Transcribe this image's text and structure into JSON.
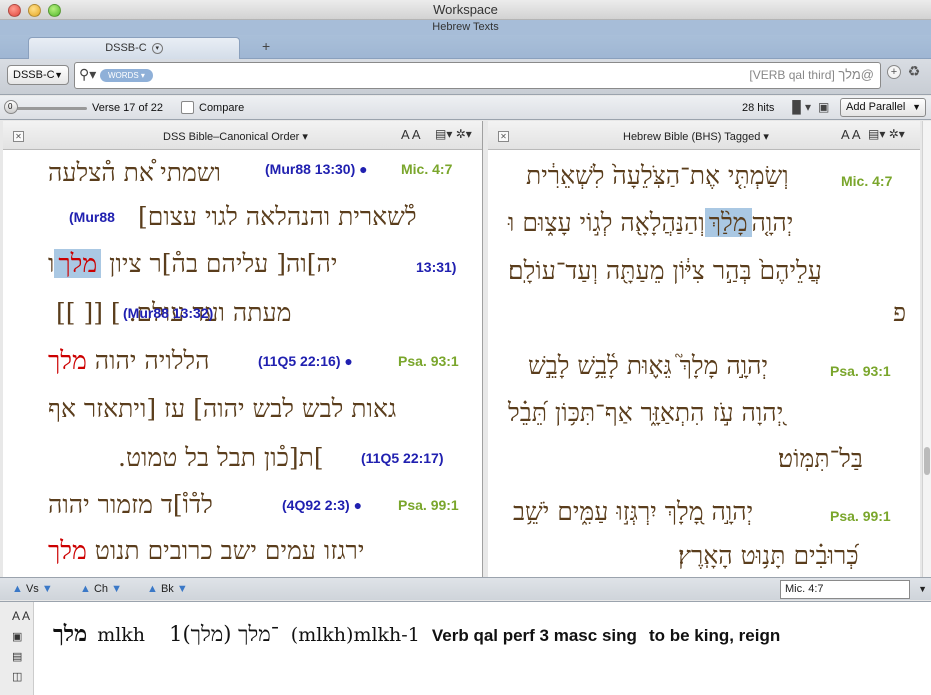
{
  "window": {
    "title": "Workspace",
    "subtitle": "Hebrew Texts"
  },
  "tabbar": {
    "tab_label": "DSSB-C",
    "add_label": "+"
  },
  "search": {
    "source_select": "DSSB-C",
    "mode_chip": "WORDS",
    "query_label": "[VERB qal third]",
    "query_hebrew": "מלך@",
    "add_icon": "plus-circle-icon",
    "recycle_icon": "recycle-icon"
  },
  "toolbar": {
    "slider_value": "0",
    "verse_text": "Verse 17 of 22",
    "compare_label": "Compare",
    "hits_text": "28 hits",
    "add_parallel_label": "Add Parallel"
  },
  "left_pane": {
    "title": "DSS Bible–Canonical Order",
    "font_size_label": "A A",
    "blocks": [
      {
        "ref": "Mic. 4:7",
        "lines": [
          {
            "manuscript": "(Mur88 13:30)",
            "text": "ושמתי ֯את ה֯צלעה"
          },
          {
            "manuscript": "(Mur88",
            "text": "ל֯שארית והנהלאה לגוי עצום]"
          },
          {
            "manuscript": "13:31)",
            "text_before": "ו",
            "highlight": "מלך",
            "text_after": "יה]וה[ עליהם בה֯]ר ציון"
          },
          {
            "manuscript": "(Mur88 13:32)",
            "text": "מעתה ועד עולם. ] [[ ]]"
          }
        ]
      },
      {
        "ref": "Psa. 93:1",
        "lines": [
          {
            "manuscript": "(11Q5 22:16)",
            "text": "הללויה יהוה",
            "red": "מלך"
          },
          {
            "manuscript": "",
            "text": "גאות לבש לבש יהוה] עז [ויתאזר אף"
          },
          {
            "manuscript": "(11Q5 22:17)",
            "text": "]ת[כ֯ון תבל בל טמוט."
          }
        ]
      },
      {
        "ref": "Psa. 99:1",
        "lines": [
          {
            "manuscript": "(4Q92 2:3)",
            "text": "לד֯ו֯]ד מזמור יהוה"
          },
          {
            "manuscript": "",
            "red": "מלך",
            "text": "ירגזו עמים ישב כרובים תנוט"
          }
        ]
      }
    ]
  },
  "right_pane": {
    "title": "Hebrew Bible (BHS) Tagged",
    "font_size_label": "A A",
    "blocks": [
      {
        "ref": "Mic. 4:7",
        "lines": [
          {
            "text": "וְשַׂמְתִּ֤י אֶת־הַצֹּֽלֵעָה֙ לִשְׁאֵרִ֔ית"
          },
          {
            "text_before": "וְהַנַּהֲלָאָ֖ה לְג֣וֹי עָצ֑וּם וּ",
            "highlight": "מָלַ֨ךְ",
            "text_after": " יְהוָ֤ה"
          },
          {
            "text": "עֲלֵיהֶם֙ בְּהַ֣ר צִיּ֔וֹן מֵעַתָּ֖ה וְעַד־עוֹלָֽם׃"
          },
          {
            "text": "פ"
          }
        ]
      },
      {
        "ref": "Psa. 93:1",
        "lines": [
          {
            "text": "יְהוָ֣ה מָלָךְ֮ גֵּא֪וּת לָ֫בֵ֥שׁ לָבֵ֣שׁ"
          },
          {
            "text": "יְ֭הוָה עֹ֣ז הִתְאַזָּ֑ר אַף־תִּכּ֥וֹן תֵּ֝בֵ֗ל"
          },
          {
            "text": "בַּל־תִּמּֽוֹט׃"
          }
        ]
      },
      {
        "ref": "Psa. 99:1",
        "lines": [
          {
            "text": "יְהוָ֣ה מָ֭לָךְ יִרְגְּז֣וּ עַמִּ֑ים יֹשֵׁ֥ב"
          },
          {
            "text": "כְּ֝רוּבִ֗ים תָּנ֥וּט הָאָֽרֶץ׃"
          }
        ]
      }
    ]
  },
  "navbar": {
    "verse_label": "Vs",
    "chapter_label": "Ch",
    "book_label": "Bk",
    "reference_value": "Mic. 4:7"
  },
  "info": {
    "font_size_label": "A A",
    "lemma_hebrew": "מלך",
    "translit": "mlkh",
    "lemma_form": "1־מלך (מלך)",
    "lemma_translit": "(mlkh)mlkh-1",
    "parsing": "Verb qal perf 3 masc sing",
    "gloss": "to be king, reign"
  },
  "colors": {
    "reference_green": "#7aa62c",
    "manuscript_blue": "#2020b0",
    "hebrew_brown": "#5a3d1c",
    "match_red": "#cc0000",
    "highlight_blue": "#aac8e3",
    "tabbar_blue": "#a7bdd8"
  }
}
